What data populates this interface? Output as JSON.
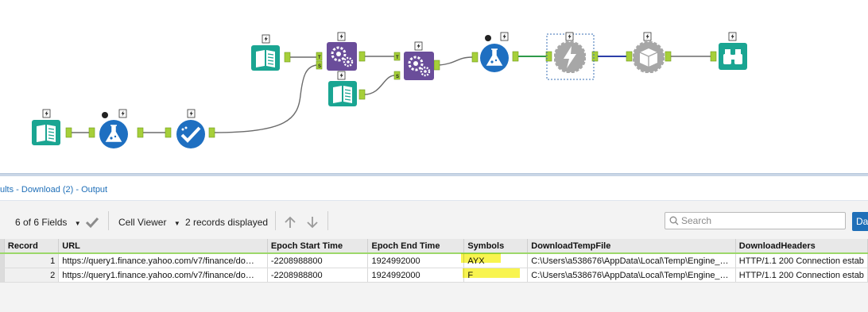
{
  "results_title": "ults - Download (2) - Output",
  "toolbar": {
    "fields_label": "6 of 6 Fields",
    "viewer_label": "Cell Viewer",
    "records_label": "2 records displayed",
    "search_placeholder": "Search",
    "data_button_label": "Da"
  },
  "table": {
    "columns": [
      "Record",
      "URL",
      "Epoch Start Time",
      "Epoch End Time",
      "Symbols",
      "DownloadTempFile",
      "DownloadHeaders"
    ],
    "rows": [
      [
        "1",
        "https://query1.finance.yahoo.com/v7/finance/do…",
        "-2208988800",
        "1924992000",
        "AYX",
        "C:\\Users\\a538676\\AppData\\Local\\Temp\\Engine_…",
        "HTTP/1.1 200 Connection estab"
      ],
      [
        "2",
        "https://query1.finance.yahoo.com/v7/finance/do…",
        "-2208988800",
        "1924992000",
        "F",
        "C:\\Users\\a538676\\AppData\\Local\\Temp\\Engine_…",
        "HTTP/1.1 200 Connection estab"
      ]
    ]
  },
  "tools": [
    {
      "name": "text-input-tool-1",
      "kind": "book",
      "color": "#1aa592"
    },
    {
      "name": "text-input-tool-2",
      "kind": "book",
      "color": "#1aa592"
    },
    {
      "name": "text-input-tool-3",
      "kind": "book",
      "color": "#1aa592"
    },
    {
      "name": "formula-tool-1",
      "kind": "flask",
      "color": "#1e6fc1"
    },
    {
      "name": "formula-tool-2",
      "kind": "flask",
      "color": "#1e6fc1"
    },
    {
      "name": "select-tool",
      "kind": "check",
      "color": "#1e6fc1"
    },
    {
      "name": "append-fields-tool-1",
      "kind": "gears",
      "color": "#6a4d9a"
    },
    {
      "name": "append-fields-tool-2",
      "kind": "gears",
      "color": "#6a4d9a"
    },
    {
      "name": "download-tool",
      "kind": "bolt",
      "color": "#a7a7a7"
    },
    {
      "name": "macro-tool",
      "kind": "box",
      "color": "#a7a7a7"
    },
    {
      "name": "browse-tool",
      "kind": "binoculars",
      "color": "#1aa592"
    }
  ],
  "colors": {
    "link_title": "#1f6fb8",
    "highlight": "#f7f230",
    "header_underline": "#9cd86a"
  }
}
